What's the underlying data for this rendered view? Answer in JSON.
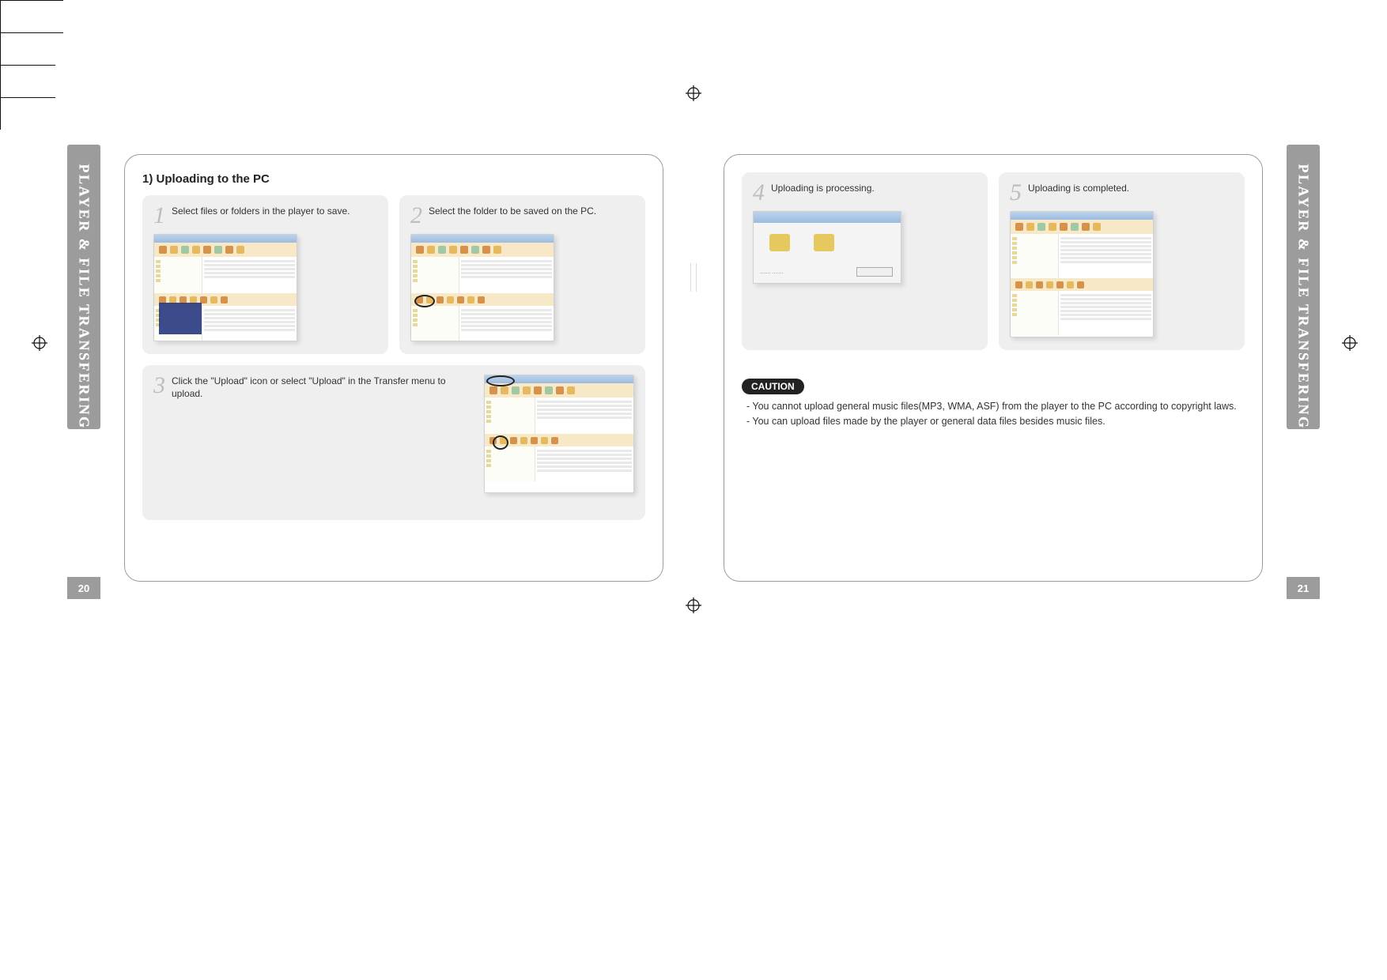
{
  "tab_title": "PLAYER & FILE TRANSFERING",
  "page_numbers": {
    "left": "20",
    "right": "21"
  },
  "left_page": {
    "section_title": "1) Uploading to the PC",
    "steps": [
      {
        "num": "1",
        "text": "Select files or folders in the player to save."
      },
      {
        "num": "2",
        "text": "Select the folder to be saved on the PC."
      },
      {
        "num": "3",
        "text": "Click the \"Upload\" icon or select \"Upload\" in the Transfer menu to upload."
      }
    ]
  },
  "right_page": {
    "steps": [
      {
        "num": "4",
        "text": "Uploading is processing."
      },
      {
        "num": "5",
        "text": "Uploading is completed."
      }
    ],
    "caution": {
      "label": "CAUTION",
      "items": [
        "- You cannot upload general music files(MP3, WMA, ASF)  from the player to the PC according to copyright laws.",
        "- You can upload files made by the player or general data files besides music files."
      ]
    }
  }
}
